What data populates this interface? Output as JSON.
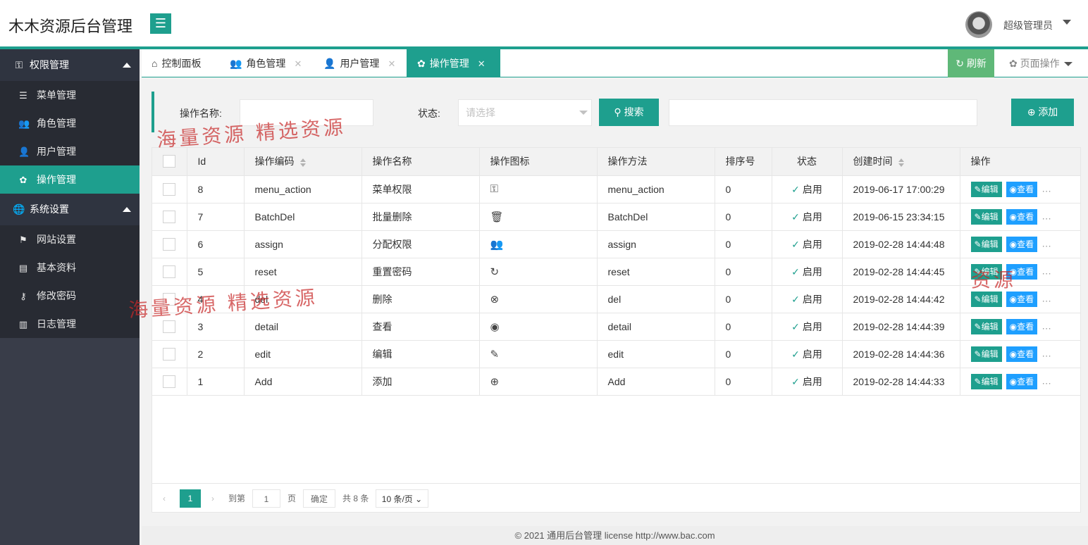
{
  "header": {
    "brand": "木木资源后台管理",
    "menu_icon": "hamburger-icon",
    "username": "超级管理员"
  },
  "sidebar": {
    "groups": [
      {
        "title": "权限管理",
        "icon": "permission-icon",
        "items": [
          {
            "label": "菜单管理",
            "icon": "list-icon"
          },
          {
            "label": "角色管理",
            "icon": "role-icon"
          },
          {
            "label": "用户管理",
            "icon": "user-icon"
          },
          {
            "label": "操作管理",
            "icon": "gear-icon",
            "active": true
          }
        ]
      },
      {
        "title": "系统设置",
        "icon": "globe-icon",
        "items": [
          {
            "label": "网站设置",
            "icon": "flag-icon"
          },
          {
            "label": "基本资料",
            "icon": "book-icon"
          },
          {
            "label": "修改密码",
            "icon": "key-icon"
          },
          {
            "label": "日志管理",
            "icon": "log-icon"
          }
        ]
      }
    ]
  },
  "tabs": [
    {
      "label": "控制面板",
      "icon": "home-icon",
      "closable": false
    },
    {
      "label": "角色管理",
      "icon": "role-icon",
      "closable": true
    },
    {
      "label": "用户管理",
      "icon": "user-icon",
      "closable": true
    },
    {
      "label": "操作管理",
      "icon": "gear-icon",
      "closable": true,
      "active": true
    }
  ],
  "toolbar": {
    "refresh_label": "刷新",
    "page_op_label": "页面操作"
  },
  "search": {
    "name_label": "操作名称:",
    "name_value": "",
    "status_label": "状态:",
    "status_placeholder": "请选择",
    "search_button": "搜索",
    "add_button": "添加"
  },
  "table": {
    "columns": [
      "Id",
      "操作编码",
      "操作名称",
      "操作图标",
      "操作方法",
      "排序号",
      "状态",
      "创建时间",
      "操作"
    ],
    "rows": [
      {
        "id": "8",
        "code": "menu_action",
        "name": "菜单权限",
        "icon": "permission-icon",
        "method": "menu_action",
        "sort": "0",
        "status": "启用",
        "created": "2019-06-17 17:00:29"
      },
      {
        "id": "7",
        "code": "BatchDel",
        "name": "批量删除",
        "icon": "trash-icon",
        "method": "BatchDel",
        "sort": "0",
        "status": "启用",
        "created": "2019-06-15 23:34:15"
      },
      {
        "id": "6",
        "code": "assign",
        "name": "分配权限",
        "icon": "role-icon",
        "method": "assign",
        "sort": "0",
        "status": "启用",
        "created": "2019-02-28 14:44:48"
      },
      {
        "id": "5",
        "code": "reset",
        "name": "重置密码",
        "icon": "reset-icon",
        "method": "reset",
        "sort": "0",
        "status": "启用",
        "created": "2019-02-28 14:44:45"
      },
      {
        "id": "4",
        "code": "del",
        "name": "删除",
        "icon": "close-circle-icon",
        "method": "del",
        "sort": "0",
        "status": "启用",
        "created": "2019-02-28 14:44:42"
      },
      {
        "id": "3",
        "code": "detail",
        "name": "查看",
        "icon": "eye-icon",
        "method": "detail",
        "sort": "0",
        "status": "启用",
        "created": "2019-02-28 14:44:39"
      },
      {
        "id": "2",
        "code": "edit",
        "name": "编辑",
        "icon": "edit-icon",
        "method": "edit",
        "sort": "0",
        "status": "启用",
        "created": "2019-02-28 14:44:36"
      },
      {
        "id": "1",
        "code": "Add",
        "name": "添加",
        "icon": "add-circle-icon",
        "method": "Add",
        "sort": "0",
        "status": "启用",
        "created": "2019-02-28 14:44:33"
      }
    ],
    "edit_label": "编辑",
    "view_label": "查看",
    "more_label": "…"
  },
  "pagination": {
    "current": "1",
    "goto_label": "到第",
    "goto_value": "1",
    "page_label": "页",
    "confirm_label": "确定",
    "total_label": "共 8 条",
    "page_size": "10 条/页"
  },
  "footer": {
    "text": "© 2021 通用后台管理 license  http://www.bac.com"
  },
  "watermarks": [
    "海量资源 精选资源",
    "海量资源 精选资源",
    "资源"
  ],
  "colors": {
    "accent": "#1e9f8e",
    "sidebar": "#393d49",
    "refresh": "#5fb878",
    "view": "#1e9fff"
  }
}
